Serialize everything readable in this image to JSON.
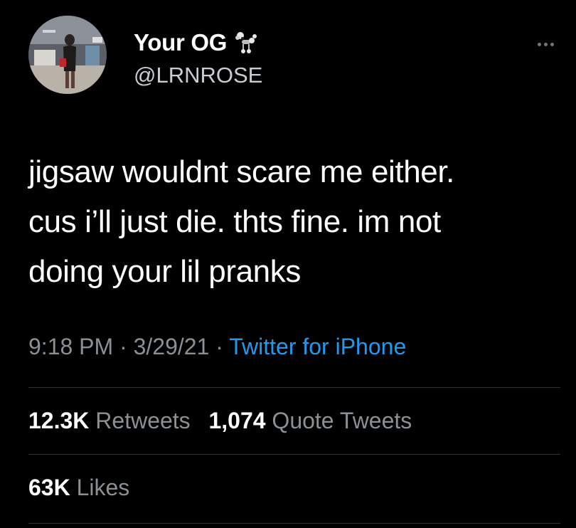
{
  "tweet": {
    "author": {
      "display_name": "Your OG",
      "handle": "@LRNROSE",
      "name_emoji": "poodle"
    },
    "text_lines": [
      "jigsaw wouldnt scare me either.",
      "cus i’ll just die. thts fine. im not",
      "doing your lil pranks"
    ],
    "meta": {
      "time": "9:18 PM",
      "sep1": " · ",
      "date": "3/29/21",
      "sep2": " · ",
      "source": "Twitter for iPhone"
    },
    "stats": {
      "retweets_count": "12.3K",
      "retweets_label": "Retweets",
      "quotes_count": "1,074",
      "quotes_label": "Quote Tweets",
      "likes_count": "63K",
      "likes_label": "Likes"
    }
  },
  "colors": {
    "background": "#000000",
    "primary_text": "#ffffff",
    "secondary_text": "#8b9095",
    "link": "#1d9bf0",
    "divider": "#2f3336"
  }
}
